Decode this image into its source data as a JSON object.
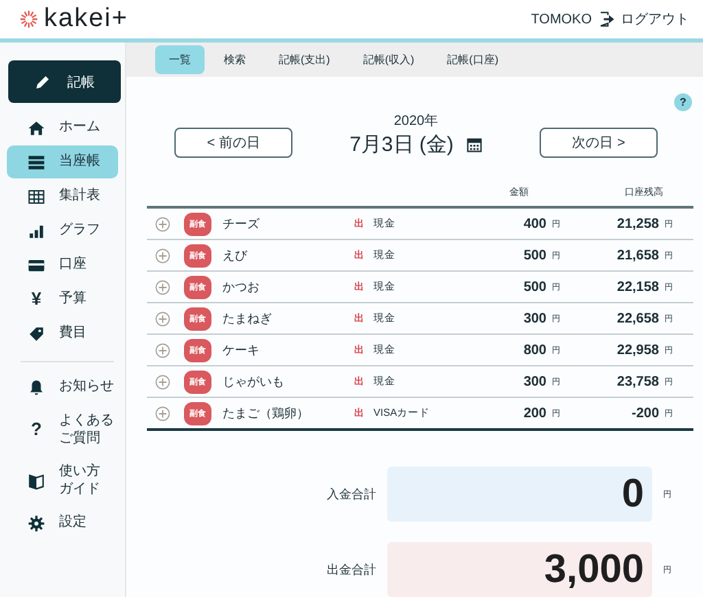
{
  "header": {
    "logo": "kakei+",
    "user": "TOMOKO",
    "logout": "ログアウト"
  },
  "sidebar": {
    "record_button": "記帳",
    "items": [
      {
        "lines": [
          "ホーム"
        ],
        "selected": false
      },
      {
        "lines": [
          "当座帳"
        ],
        "selected": true
      },
      {
        "lines": [
          "集計表"
        ],
        "selected": false
      },
      {
        "lines": [
          "グラフ"
        ],
        "selected": false
      },
      {
        "lines": [
          "口座"
        ],
        "selected": false
      },
      {
        "lines": [
          "予算"
        ],
        "glyph": "¥",
        "selected": false
      },
      {
        "lines": [
          "費目"
        ],
        "selected": false
      }
    ],
    "secondary_items": [
      {
        "lines": [
          "お知らせ"
        ],
        "selected": false
      },
      {
        "lines": [
          "よくある",
          "ご質問"
        ],
        "glyph": "?",
        "selected": false
      },
      {
        "lines": [
          "使い方",
          "ガイド"
        ],
        "selected": false
      },
      {
        "lines": [
          "設定"
        ],
        "selected": false
      }
    ]
  },
  "tabs": [
    {
      "label": "一覧",
      "selected": true
    },
    {
      "label": "検索",
      "selected": false
    },
    {
      "label": "記帳(支出)",
      "selected": false
    },
    {
      "label": "記帳(収入)",
      "selected": false
    },
    {
      "label": "記帳(口座)",
      "selected": false
    }
  ],
  "help": "?",
  "date": {
    "year": "2020年",
    "day": "7月3日 (金)",
    "prev": "< 前の日",
    "next": "次の日 >"
  },
  "columns": {
    "amount": "金額",
    "balance": "口座残高"
  },
  "rows": [
    {
      "category": "副食",
      "name": "チーズ",
      "type": "出",
      "account": "現金",
      "amount": "400",
      "amount_unit": "円",
      "balance": "21,258",
      "balance_unit": "円"
    },
    {
      "category": "副食",
      "name": "えび",
      "type": "出",
      "account": "現金",
      "amount": "500",
      "amount_unit": "円",
      "balance": "21,658",
      "balance_unit": "円"
    },
    {
      "category": "副食",
      "name": "かつお",
      "type": "出",
      "account": "現金",
      "amount": "500",
      "amount_unit": "円",
      "balance": "22,158",
      "balance_unit": "円"
    },
    {
      "category": "副食",
      "name": "たまねぎ",
      "type": "出",
      "account": "現金",
      "amount": "300",
      "amount_unit": "円",
      "balance": "22,658",
      "balance_unit": "円"
    },
    {
      "category": "副食",
      "name": "ケーキ",
      "type": "出",
      "account": "現金",
      "amount": "800",
      "amount_unit": "円",
      "balance": "22,958",
      "balance_unit": "円"
    },
    {
      "category": "副食",
      "name": "じゃがいも",
      "type": "出",
      "account": "現金",
      "amount": "300",
      "amount_unit": "円",
      "balance": "23,758",
      "balance_unit": "円"
    },
    {
      "category": "副食",
      "name": "たまご（鶏卵）",
      "type": "出",
      "account": "VISAカード",
      "amount": "200",
      "amount_unit": "円",
      "balance": "-200",
      "balance_unit": "円"
    }
  ],
  "totals": [
    {
      "kind": "income",
      "label": "入金合計",
      "value": "0",
      "unit": "円"
    },
    {
      "kind": "expense",
      "label": "出金合計",
      "value": "3,000",
      "unit": "円"
    }
  ]
}
